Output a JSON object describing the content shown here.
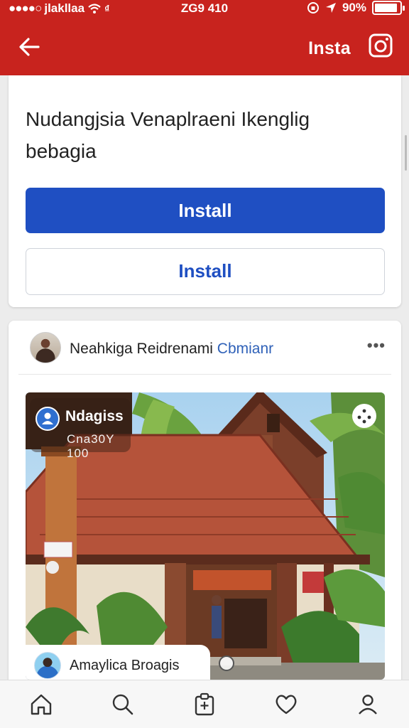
{
  "status_bar": {
    "carrier": "jlakllaa",
    "time": "ZG9 410",
    "battery_text": "90%",
    "battery_level": 0.9
  },
  "app_bar": {
    "title": "Insta",
    "back_icon": "arrow-left-icon",
    "camera_icon": "instagram-camera-icon"
  },
  "install_card": {
    "message": "Nudangjsia Venaplraeni Ikenglig bebagia",
    "primary_button": "Install",
    "secondary_button": "Install"
  },
  "post": {
    "author_name": "Neahkiga Reidrenami",
    "author_link": "Cbmianr",
    "more_icon": "more-horizontal-icon",
    "photo_tag": {
      "name": "Ndagiss",
      "subtitle": "Cna30Y 100"
    },
    "caption_user": "Amaylica Broagis"
  },
  "bottom_nav": {
    "items": [
      "home-icon",
      "search-icon",
      "add-post-icon",
      "heart-icon",
      "profile-icon"
    ]
  },
  "colors": {
    "brand_red": "#c8231e",
    "primary_blue": "#1f4fc2",
    "link_blue": "#2f61b8"
  }
}
